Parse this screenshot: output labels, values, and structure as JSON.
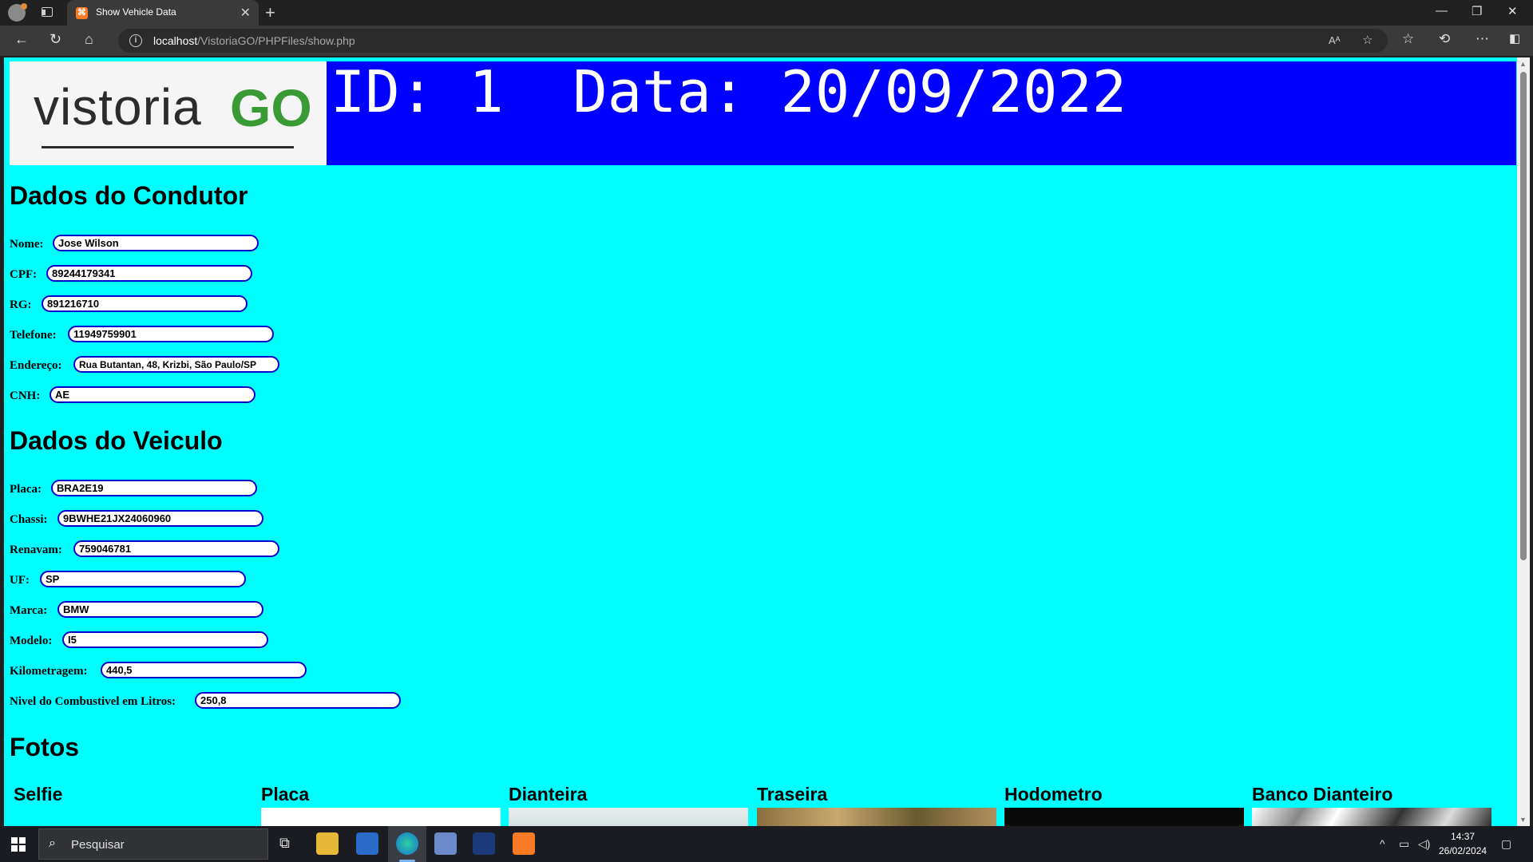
{
  "browser": {
    "tab_title": "Show Vehicle Data",
    "url_host": "localhost",
    "url_path": "/VistoriaGO/PHPFiles/show.php"
  },
  "logo": {
    "left": "vistoria",
    "right": "GO"
  },
  "header": {
    "text": "ID: 1  Data: 20/09/2022"
  },
  "condutor": {
    "title": "Dados do Condutor",
    "fields": [
      {
        "label": "Nome:",
        "value": "Jose Wilson"
      },
      {
        "label": "CPF:",
        "value": "89244179341"
      },
      {
        "label": "RG:",
        "value": "891216710"
      },
      {
        "label": "Telefone:",
        "value": "11949759901"
      },
      {
        "label": "Endereço:",
        "value": "Rua Butantan, 48, Krizbi, São Paulo/SP"
      },
      {
        "label": "CNH:",
        "value": "AE"
      }
    ]
  },
  "veiculo": {
    "title": "Dados do Veiculo",
    "fields": [
      {
        "label": "Placa:",
        "value": "BRA2E19"
      },
      {
        "label": "Chassi:",
        "value": "9BWHE21JX24060960"
      },
      {
        "label": "Renavam:",
        "value": "759046781"
      },
      {
        "label": "UF:",
        "value": "SP"
      },
      {
        "label": "Marca:",
        "value": "BMW"
      },
      {
        "label": "Modelo:",
        "value": "I5"
      },
      {
        "label": "Kilometragem:",
        "value": "440,5"
      },
      {
        "label": "Nivel do Combustivel em Litros:",
        "value": "250,8"
      }
    ]
  },
  "fotos": {
    "title": "Fotos",
    "items": [
      "Selfie",
      "Placa",
      "Dianteira",
      "Traseira",
      "Hodometro",
      "Banco Dianteiro"
    ]
  },
  "taskbar": {
    "search_placeholder": "Pesquisar",
    "time": "14:37",
    "date": "26/02/2024"
  }
}
